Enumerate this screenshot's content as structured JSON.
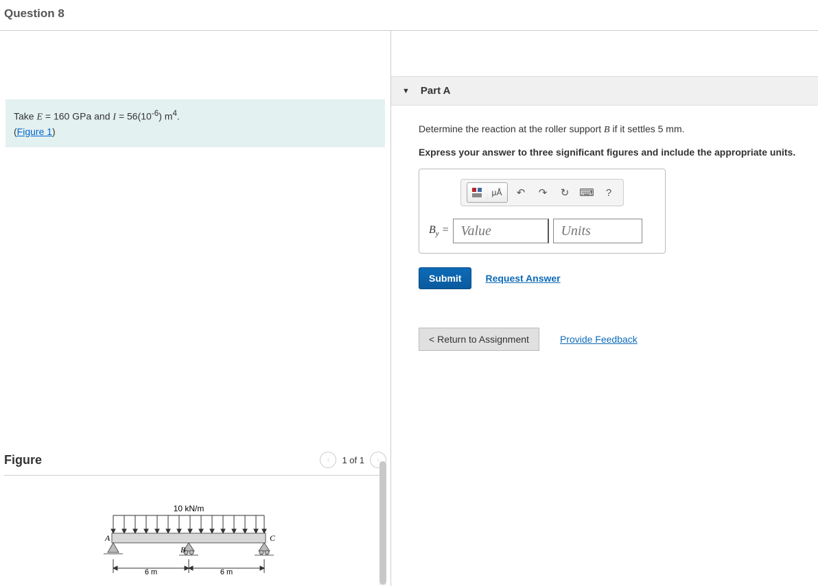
{
  "header": {
    "title": "Question 8"
  },
  "problem": {
    "prefix": "Take ",
    "e_sym": "E",
    "e_eq": " = 160 ",
    "e_unit": "GPa",
    "and": " and ",
    "i_sym": "I",
    "i_eq": " = 56(10",
    "i_exp": "-6",
    "i_close": ")",
    "i_unit": " m",
    "i_ue": "4",
    "period": ".",
    "figure_link": "Figure 1"
  },
  "figure": {
    "title": "Figure",
    "nav_label": "1 of 1",
    "load_label": "10 kN/m",
    "labelA": "A",
    "labelB": "B",
    "labelC": "C",
    "dim1": "6 m",
    "dim2": "6 m"
  },
  "partA": {
    "title": "Part A",
    "prompt_pre": "Determine the reaction at the roller support ",
    "prompt_var": "B",
    "prompt_post": " if it settles 5 ",
    "prompt_unit": "mm",
    "prompt_end": ".",
    "instruction": "Express your answer to three significant figures and include the appropriate units.",
    "answer_label": "B",
    "answer_sub": "y",
    "answer_eq": " = ",
    "value_placeholder": "Value",
    "units_placeholder": "Units",
    "submit": "Submit",
    "request": "Request Answer"
  },
  "footer": {
    "return": "Return to Assignment",
    "feedback": "Provide Feedback"
  },
  "toolbar": {
    "templates": "templates-icon",
    "greek": "μÅ",
    "undo": "↶",
    "redo": "↷",
    "reset": "↻",
    "keyboard": "⌨",
    "help": "?"
  }
}
